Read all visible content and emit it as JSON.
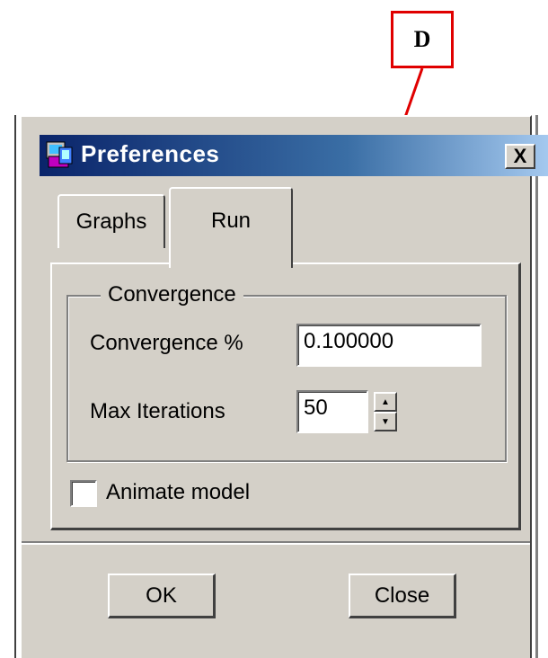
{
  "annotation": {
    "callout_letter": "D",
    "color": "#e00000"
  },
  "window": {
    "title": "Preferences",
    "close_glyph": "X"
  },
  "tabs": [
    {
      "label": "Graphs",
      "active": false
    },
    {
      "label": "Run",
      "active": true
    }
  ],
  "convergence_group": {
    "label": "Convergence",
    "convergence_pct": {
      "label": "Convergence %",
      "value": "0.100000"
    },
    "max_iterations": {
      "label": "Max Iterations",
      "value": "50"
    }
  },
  "animate_model": {
    "label": "Animate model",
    "checked": false
  },
  "buttons": {
    "ok": "OK",
    "close": "Close"
  },
  "colors": {
    "face": "#d4d0c8",
    "title_start": "#0a246a",
    "title_end": "#a6caf0"
  }
}
